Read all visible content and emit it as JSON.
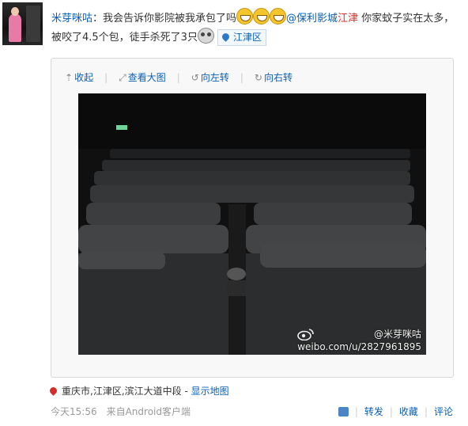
{
  "post": {
    "author": "米芽咪咕",
    "colon": "：",
    "text1": "我会告诉你影院被我承包了吗",
    "mention_prefix": "@保利影城",
    "mention_red": "江津",
    "text2": " 你家蚊子实在太多，被咬了4.5个包，徒手杀死了3只",
    "location_tag": "江津区",
    "emoji": [
      "laugh-emoji",
      "laugh-emoji",
      "laugh-emoji",
      "owl-emoji"
    ]
  },
  "media": {
    "tools": [
      {
        "icon": "⇡",
        "label": "收起"
      },
      {
        "icon": "⤢",
        "label": "查看大图"
      },
      {
        "icon": "↺",
        "label": "向左转"
      },
      {
        "icon": "↻",
        "label": "向右转"
      }
    ],
    "watermark_handle": "@米芽咪咕",
    "watermark_url": "weibo.com/u/2827961895"
  },
  "geo": {
    "address": "重庆市,江津区,滨江大道中段",
    "separator": " - ",
    "map_link": "显示地图"
  },
  "footer": {
    "time": "今天15:56",
    "source": "来自Android客户端",
    "actions": [
      "转发",
      "收藏",
      "评论"
    ]
  },
  "colors": {
    "link": "#0a5fb4",
    "mention_red": "#d2342a"
  }
}
